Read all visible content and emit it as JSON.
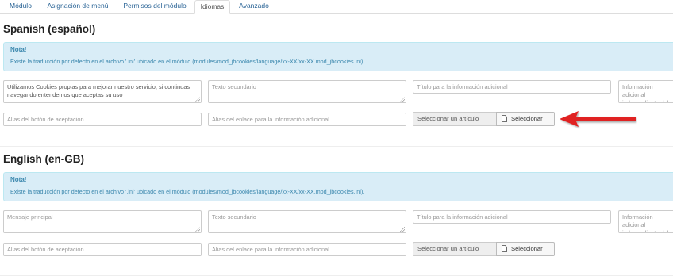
{
  "tabs": [
    {
      "label": "Módulo",
      "active": false
    },
    {
      "label": "Asignación de menú",
      "active": false
    },
    {
      "label": "Permisos del módulo",
      "active": false
    },
    {
      "label": "Idiomas",
      "active": true
    },
    {
      "label": "Avanzado",
      "active": false
    }
  ],
  "sections": [
    {
      "title": "Spanish (español)",
      "note_title": "Nota!",
      "note_text": "Existe la traducción por defecto en el archivo '.ini' ubicado en el módulo (modules/mod_jbcookies/language/xx-XX/xx-XX.mod_jbcookies.ini).",
      "main_message_value": "Utilizamos Cookies propias para mejorar nuestro servicio, si continuas navegando entendemos que aceptas su uso",
      "secondary_text_placeholder": "Texto secundario",
      "info_title_placeholder": "Título para la información adicional",
      "independent_info_placeholder": "Información adicional independiente del artículo",
      "accept_alias_placeholder": "Alias del botón de aceptación",
      "link_alias_placeholder": "Alias del enlace para la información adicional",
      "select_article_text": "Seleccionar un artículo",
      "select_button_label": "Seleccionar"
    },
    {
      "title": "English (en-GB)",
      "note_title": "Nota!",
      "note_text": "Existe la traducción por defecto en el archivo '.ini' ubicado en el módulo (modules/mod_jbcookies/language/xx-XX/xx-XX.mod_jbcookies.ini).",
      "main_message_placeholder": "Mensaje principal",
      "secondary_text_placeholder": "Texto secundario",
      "info_title_placeholder": "Título para la información adicional",
      "independent_info_placeholder": "Información adicional independiente del artículo",
      "accept_alias_placeholder": "Alias del botón de aceptación",
      "link_alias_placeholder": "Alias del enlace para la información adicional",
      "select_article_text": "Seleccionar un artículo",
      "select_button_label": "Seleccionar"
    }
  ],
  "annotation": {
    "arrow_color": "#e02020"
  },
  "colors": {
    "link": "#2a6496",
    "note_bg": "#d9edf7",
    "note_text": "#3a87ad"
  }
}
